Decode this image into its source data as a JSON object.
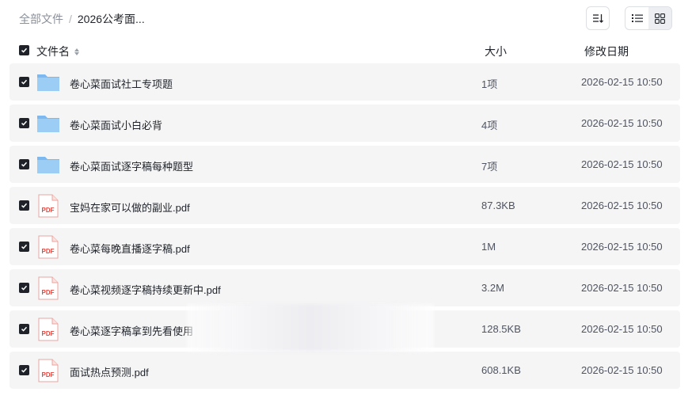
{
  "breadcrumb": {
    "root": "全部文件",
    "separator": "/",
    "current": "2026公考面..."
  },
  "toolbar": {
    "sort_icon": "sort-icon",
    "list_view_icon": "list-view-icon",
    "grid_view_icon": "grid-view-icon",
    "active_view": "list"
  },
  "columns": {
    "name": "文件名",
    "size": "大小",
    "date": "修改日期"
  },
  "files": [
    {
      "type": "folder",
      "name": "卷心菜面试社工专项题",
      "size": "1项",
      "date": "2026-02-15 10:50",
      "selected": true
    },
    {
      "type": "folder",
      "name": "卷心菜面试小白必背",
      "size": "4项",
      "date": "2026-02-15 10:50",
      "selected": true
    },
    {
      "type": "folder",
      "name": "卷心菜面试逐字稿每种题型",
      "size": "7项",
      "date": "2026-02-15 10:50",
      "selected": true
    },
    {
      "type": "pdf",
      "name": "宝妈在家可以做的副业.pdf",
      "size": "87.3KB",
      "date": "2026-02-15 10:50",
      "selected": true,
      "badge": "PDF"
    },
    {
      "type": "pdf",
      "name": "卷心菜每晚直播逐字稿.pdf",
      "size": "1M",
      "date": "2026-02-15 10:50",
      "selected": true,
      "badge": "PDF"
    },
    {
      "type": "pdf",
      "name": "卷心菜视频逐字稿持续更新中.pdf",
      "size": "3.2M",
      "date": "2026-02-15 10:50",
      "selected": true,
      "badge": "PDF"
    },
    {
      "type": "pdf",
      "name": "卷心菜逐字稿拿到先看使用",
      "size": "128.5KB",
      "date": "2026-02-15 10:50",
      "selected": true,
      "badge": "PDF"
    },
    {
      "type": "pdf",
      "name": "面试热点预测.pdf",
      "size": "608.1KB",
      "date": "2026-02-15 10:50",
      "selected": true,
      "badge": "PDF"
    }
  ],
  "colors": {
    "folder": "#8cc3f2",
    "pdf": "#e2453c",
    "row_bg": "#f5f5f6",
    "checkbox": "#1f2329"
  }
}
